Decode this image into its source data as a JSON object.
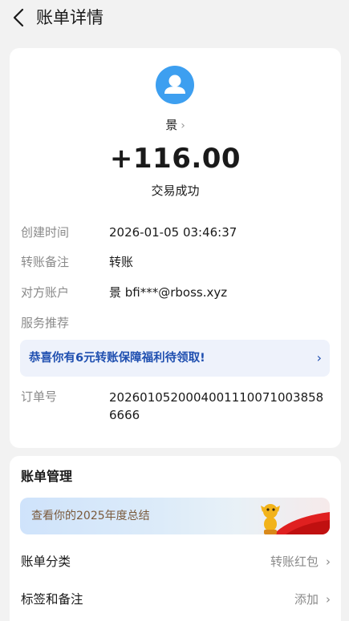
{
  "header": {
    "title": "账单详情",
    "back_icon": "back-arrow-icon"
  },
  "transaction": {
    "counterparty": "景",
    "amount": "+116.00",
    "status": "交易成功",
    "avatar_icon": "user-avatar-icon",
    "avatar_color": "#3d9ff0"
  },
  "details": {
    "created_time_label": "创建时间",
    "created_time_value": "2026-01-05 03:46:37",
    "memo_label": "转账备注",
    "memo_value": "转账",
    "account_label": "对方账户",
    "account_value": "景 bfi***@rboss.xyz",
    "service_label": "服务推荐",
    "promo_text": "恭喜你有6元转账保障福利待领取!",
    "order_label": "订单号",
    "order_value": "20260105200040011100710038586666"
  },
  "management": {
    "title": "账单管理",
    "banner_text": "查看你的2025年度总结",
    "category_label": "账单分类",
    "category_value": "转账红包",
    "tags_label": "标签和备注",
    "tags_value": "添加"
  },
  "colors": {
    "accent_blue": "#1f4fb0",
    "promo_bg": "#eef2fb",
    "page_bg": "#f2f2f2"
  }
}
